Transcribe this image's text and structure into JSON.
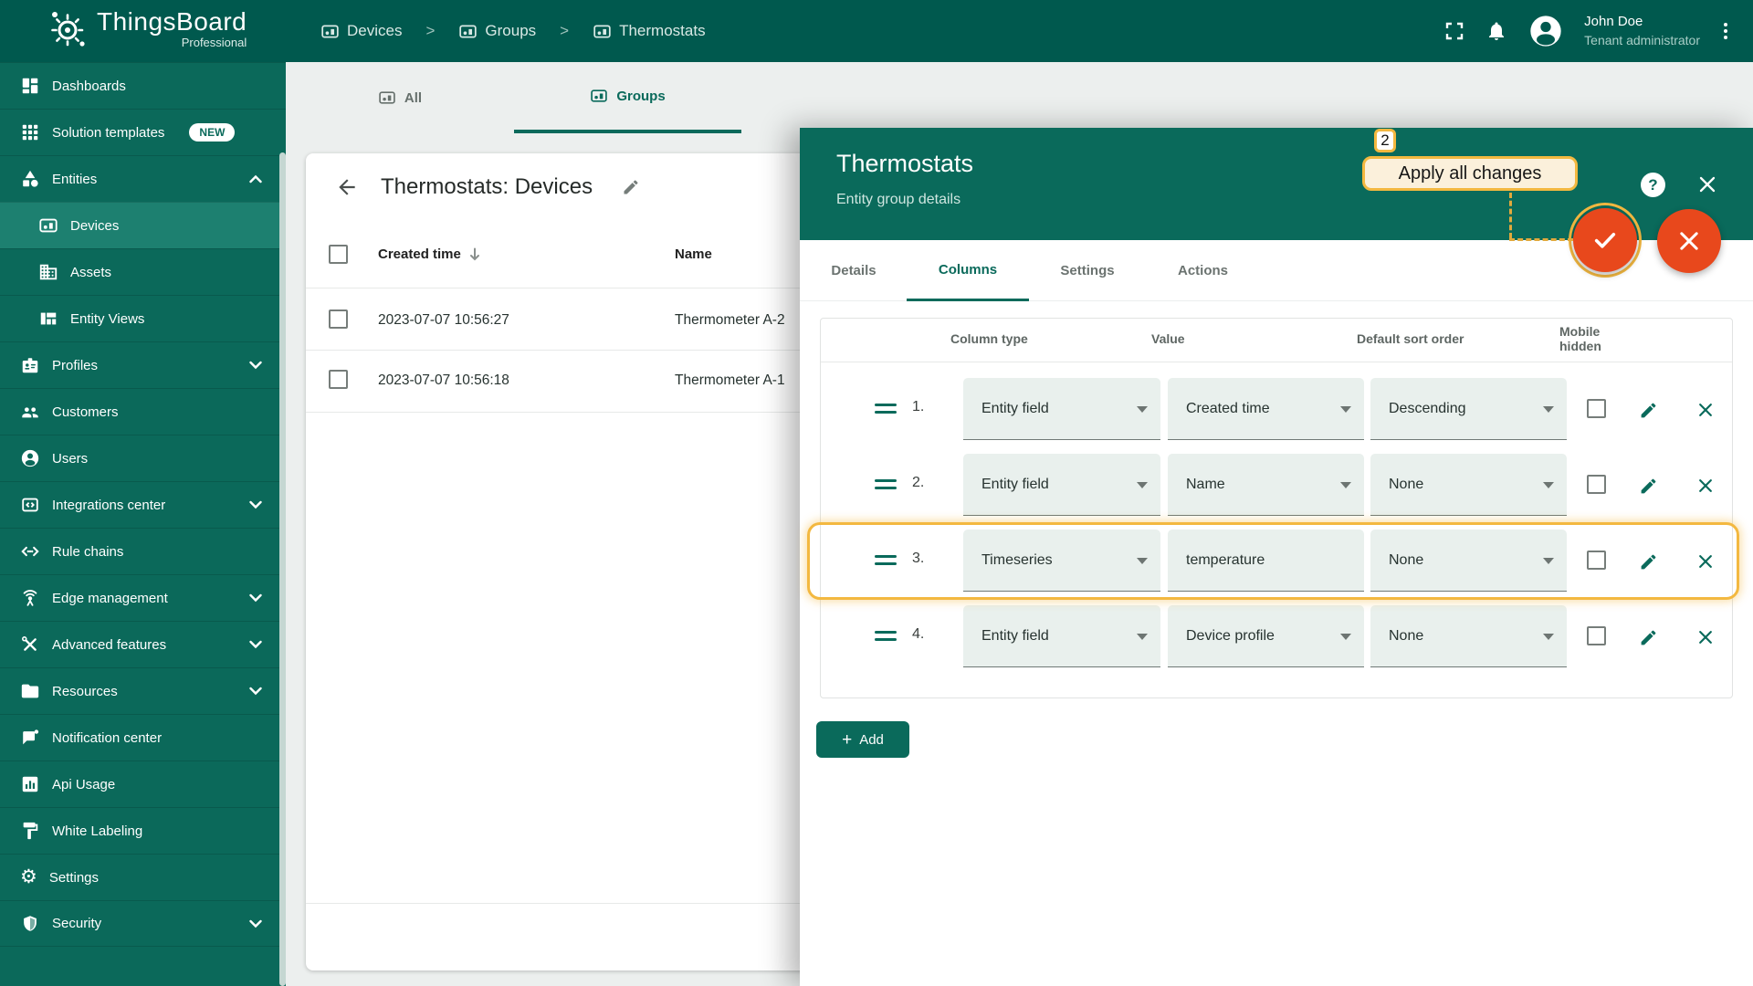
{
  "topbar": {
    "logo": {
      "title": "ThingsBoard",
      "subtitle": "Professional"
    },
    "breadcrumbs": [
      {
        "label": "Devices",
        "icon": "devices-icon"
      },
      {
        "label": "Groups",
        "icon": "devices-icon"
      },
      {
        "label": "Thermostats",
        "icon": "devices-icon"
      }
    ],
    "separator": ">",
    "icons": [
      "fullscreen-icon",
      "notifications-bell-icon",
      "avatar-icon",
      "kebab-menu-icon"
    ],
    "user": {
      "name": "John Doe",
      "role": "Tenant administrator"
    }
  },
  "sidebar": {
    "items": [
      {
        "label": "Dashboards",
        "icon": "dashboard-icon"
      },
      {
        "label": "Solution templates",
        "icon": "apps-grid-icon",
        "badge": "NEW"
      },
      {
        "label": "Entities",
        "icon": "category-icon",
        "chevron": "up"
      },
      {
        "label": "Devices",
        "icon": "devices-icon",
        "sub": true,
        "selected": true
      },
      {
        "label": "Assets",
        "icon": "building-icon",
        "sub": true
      },
      {
        "label": "Entity Views",
        "icon": "view-quilt-icon",
        "sub": true
      },
      {
        "label": "Profiles",
        "icon": "badge-icon",
        "chevron": "down"
      },
      {
        "label": "Customers",
        "icon": "people-icon"
      },
      {
        "label": "Users",
        "icon": "account-circle-icon"
      },
      {
        "label": "Integrations center",
        "icon": "integration-icon",
        "chevron": "down"
      },
      {
        "label": "Rule chains",
        "icon": "settings-ethernet-icon"
      },
      {
        "label": "Edge management",
        "icon": "antenna-icon",
        "chevron": "down"
      },
      {
        "label": "Advanced features",
        "icon": "tools-icon",
        "chevron": "down"
      },
      {
        "label": "Resources",
        "icon": "folder-icon",
        "chevron": "down"
      },
      {
        "label": "Notification center",
        "icon": "chat-notification-icon"
      },
      {
        "label": "Api Usage",
        "icon": "bar-chart-icon"
      },
      {
        "label": "White Labeling",
        "icon": "paint-roller-icon"
      },
      {
        "label": "Settings",
        "icon": "gear-icon"
      },
      {
        "label": "Security",
        "icon": "shield-icon",
        "chevron": "down"
      }
    ]
  },
  "content_tabs": {
    "all": "All",
    "groups": "Groups"
  },
  "group_view": {
    "title": "Thermostats: Devices",
    "table": {
      "headers": {
        "created_time": "Created time",
        "name": "Name"
      },
      "rows": [
        {
          "created_time": "2023-07-07 10:56:27",
          "name": "Thermometer A-2"
        },
        {
          "created_time": "2023-07-07 10:56:18",
          "name": "Thermometer A-1"
        }
      ]
    }
  },
  "drawer": {
    "title": "Thermostats",
    "subtitle": "Entity group details",
    "tabs": [
      "Details",
      "Columns",
      "Settings",
      "Actions"
    ],
    "active_tab": "Columns",
    "columns_table": {
      "headers": {
        "column_type": "Column type",
        "value": "Value",
        "sort_order": "Default sort order",
        "mobile_hidden": "Mobile hidden"
      },
      "rows": [
        {
          "index": "1.",
          "column_type": "Entity field",
          "value": "Created time",
          "sort_order": "Descending",
          "highlighted": false
        },
        {
          "index": "2.",
          "column_type": "Entity field",
          "value": "Name",
          "sort_order": "None",
          "highlighted": false
        },
        {
          "index": "3.",
          "column_type": "Timeseries",
          "value": "temperature",
          "sort_order": "None",
          "highlighted": true
        },
        {
          "index": "4.",
          "column_type": "Entity field",
          "value": "Device profile",
          "sort_order": "None",
          "highlighted": false
        }
      ]
    },
    "add_button": "Add"
  },
  "annotation": {
    "step": "2",
    "label": "Apply all changes"
  },
  "colors": {
    "topbar": "#00594E",
    "sidebar": "#0B695A",
    "sidebar_selected": "#1D8070",
    "primary": "#0A6A5B",
    "fab_orange": "#E8481C",
    "annotation_gold": "#F3B840",
    "field_fill": "#E9F0ED"
  }
}
